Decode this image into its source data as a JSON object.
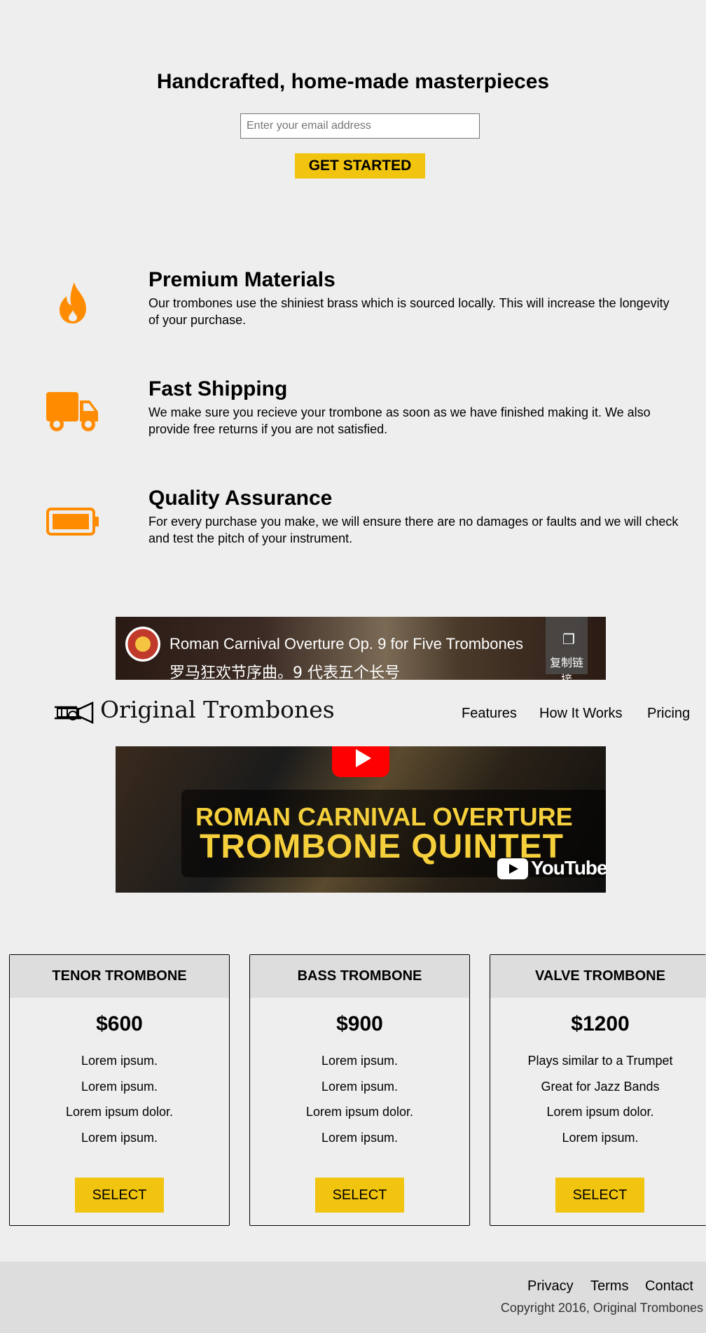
{
  "hero": {
    "title": "Handcrafted, home-made masterpieces",
    "email_placeholder": "Enter your email address",
    "cta_label": "GET STARTED"
  },
  "features": [
    {
      "icon": "flame-icon",
      "title": "Premium Materials",
      "text": "Our trombones use the shiniest brass which is sourced locally. This will increase the longevity",
      "text2": "of your purchase."
    },
    {
      "icon": "truck-icon",
      "title": "Fast Shipping",
      "text": "We make sure you recieve your trombone as soon as we have finished making it. We also",
      "text2": "provide free returns if you are not satisfied."
    },
    {
      "icon": "battery-icon",
      "title": "Quality Assurance",
      "text": "For every purchase you make, we will ensure there are no damages or faults and we will check",
      "text2": "and test the pitch of your instrument."
    }
  ],
  "video": {
    "title": "Roman Carnival Overture Op. 9 for Five Trombones",
    "subtitle": "罗马狂欢节序曲。9 代表五个长号",
    "copy_label": "复制链接",
    "thumb_line1": "ROMAN CARNIVAL OVERTURE",
    "thumb_line2": "TROMBONE QUINTET",
    "platform": "YouTube"
  },
  "header": {
    "logo_text": "Original Trombones",
    "nav": [
      "Features",
      "How It Works",
      "Pricing"
    ]
  },
  "pricing": [
    {
      "name": "TENOR TROMBONE",
      "price": "$600",
      "features": [
        "Lorem ipsum.",
        "Lorem ipsum.",
        "Lorem ipsum dolor.",
        "Lorem ipsum."
      ],
      "button": "SELECT"
    },
    {
      "name": "BASS TROMBONE",
      "price": "$900",
      "features": [
        "Lorem ipsum.",
        "Lorem ipsum.",
        "Lorem ipsum dolor.",
        "Lorem ipsum."
      ],
      "button": "SELECT"
    },
    {
      "name": "VALVE TROMBONE",
      "price": "$1200",
      "features": [
        "Plays similar to a Trumpet",
        "Great for Jazz Bands",
        "Lorem ipsum dolor.",
        "Lorem ipsum."
      ],
      "button": "SELECT"
    }
  ],
  "footer": {
    "links": [
      "Privacy",
      "Terms",
      "Contact"
    ],
    "copyright": "Copyright 2016, Original Trombones"
  },
  "colors": {
    "accent": "#f1c40f",
    "icon_orange": "#ff8c00",
    "background": "#eeeeee",
    "panel": "#dddddd"
  }
}
